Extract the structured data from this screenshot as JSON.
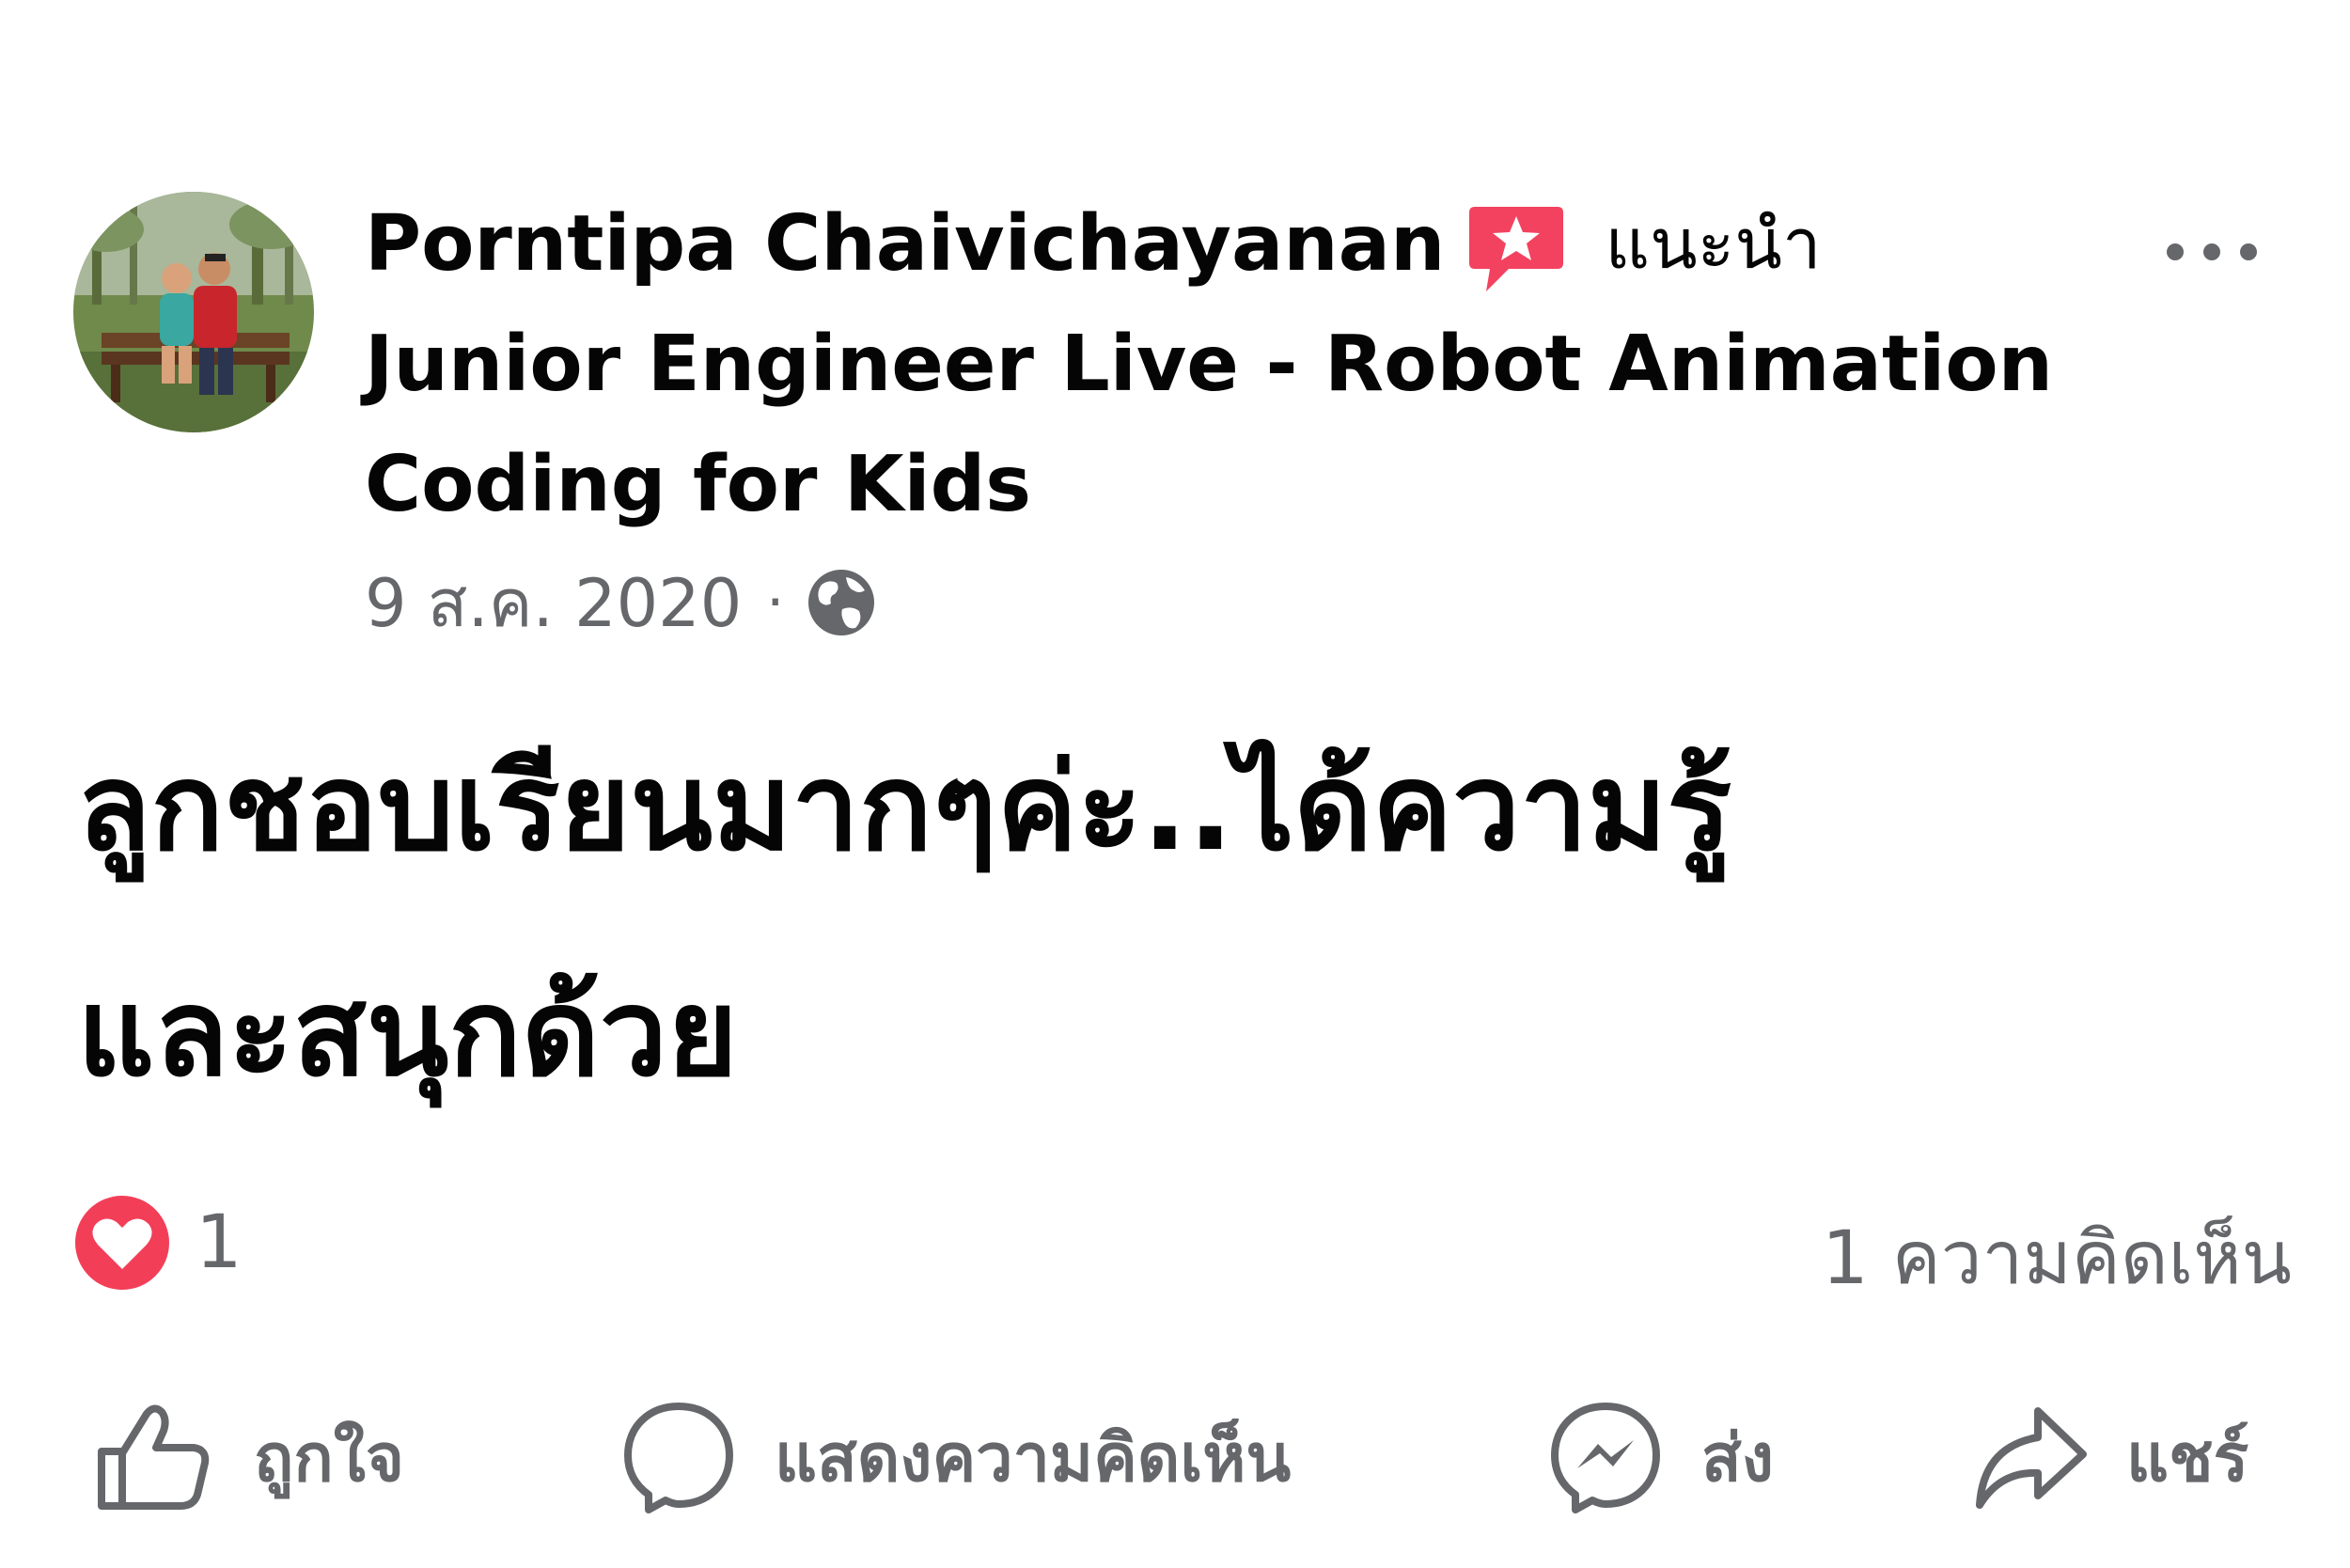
{
  "post": {
    "author": {
      "name": "Porntipa Chaivichayanan",
      "badge_icon": "rising-star-badge-icon",
      "badge_label": "แนะนำ",
      "avatar_icon": "profile-photo"
    },
    "page_line_1": "Junior Engineer Live - Robot Animation",
    "page_line_2": "Coding for Kids",
    "date": "9 ส.ค. 2020",
    "separator": "·",
    "audience_icon": "globe-icon",
    "more_icon": "more-options-icon",
    "content_line_1": "ลูกชอบเรียนมากๆค่ะ..ได้ความรู้",
    "content_line_2": "และสนุกด้วย"
  },
  "stats": {
    "reaction_icon": "heart-reaction-icon",
    "reaction_count": "1",
    "comment_count": "1 ความคิดเห็น"
  },
  "actions": {
    "like": "ถูกใจ",
    "comment": "แสดงความคิดเห็น",
    "send": "ส่ง",
    "share": "แชร์"
  },
  "colors": {
    "text_primary": "#050505",
    "text_secondary": "#65676b",
    "badge_pink": "#f3425f",
    "heart_red": "#f33e58"
  }
}
